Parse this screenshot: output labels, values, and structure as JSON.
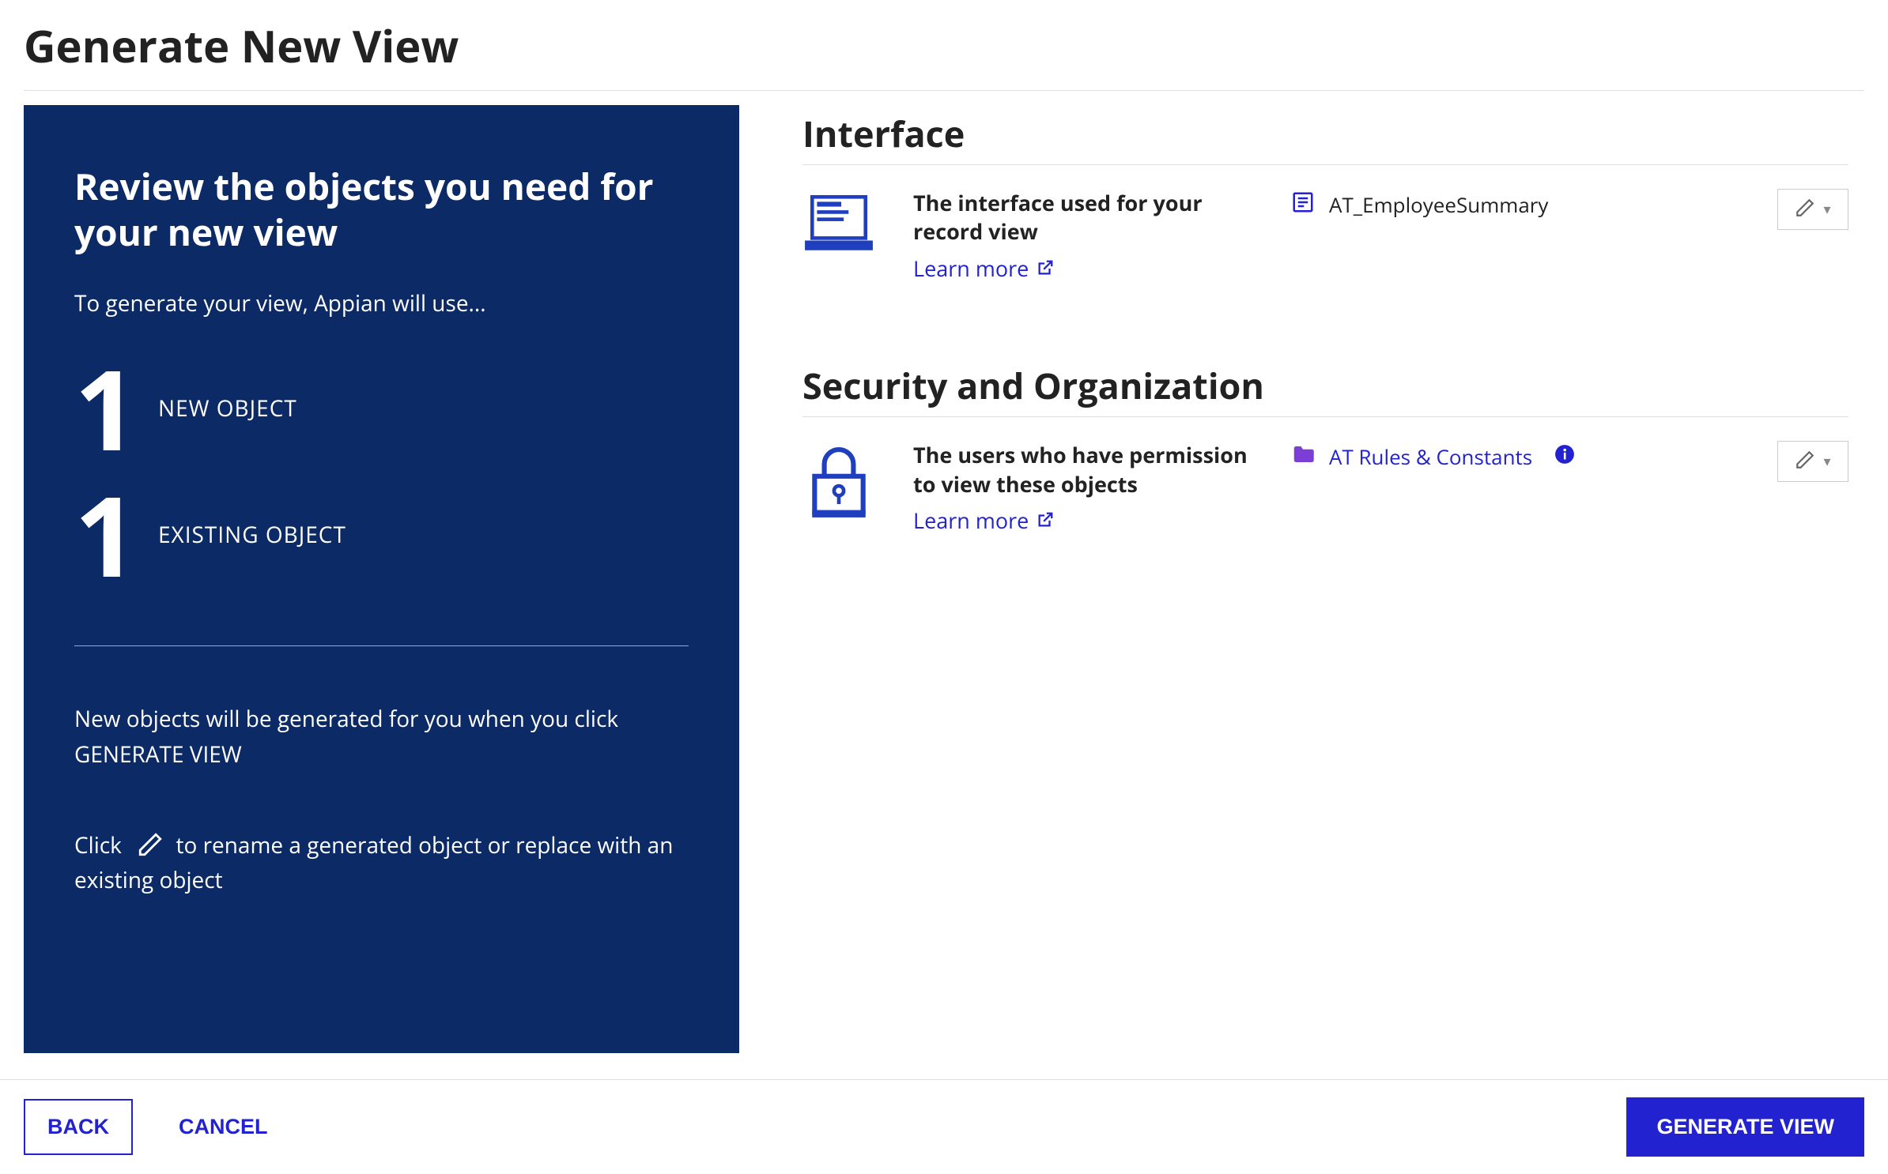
{
  "header": {
    "title": "Generate New View"
  },
  "left_panel": {
    "heading": "Review the objects you need for your new view",
    "subtitle": "To generate your view, Appian will use...",
    "new_count": "1",
    "new_label": "NEW OBJECT",
    "existing_count": "1",
    "existing_label": "EXISTING OBJECT",
    "note": "New objects will be generated for you when you click GENERATE VIEW",
    "rename_prefix": "Click",
    "rename_suffix": "to rename a generated object or replace with an existing object"
  },
  "sections": {
    "interface": {
      "title": "Interface",
      "description": "The interface used for your record view",
      "learn_more": "Learn more",
      "value": "AT_EmployeeSummary"
    },
    "security": {
      "title": "Security and Organization",
      "description": "The users who have permission to view these objects",
      "learn_more": "Learn more",
      "value": "AT Rules & Constants"
    }
  },
  "footer": {
    "back": "BACK",
    "cancel": "CANCEL",
    "generate": "GENERATE VIEW"
  }
}
